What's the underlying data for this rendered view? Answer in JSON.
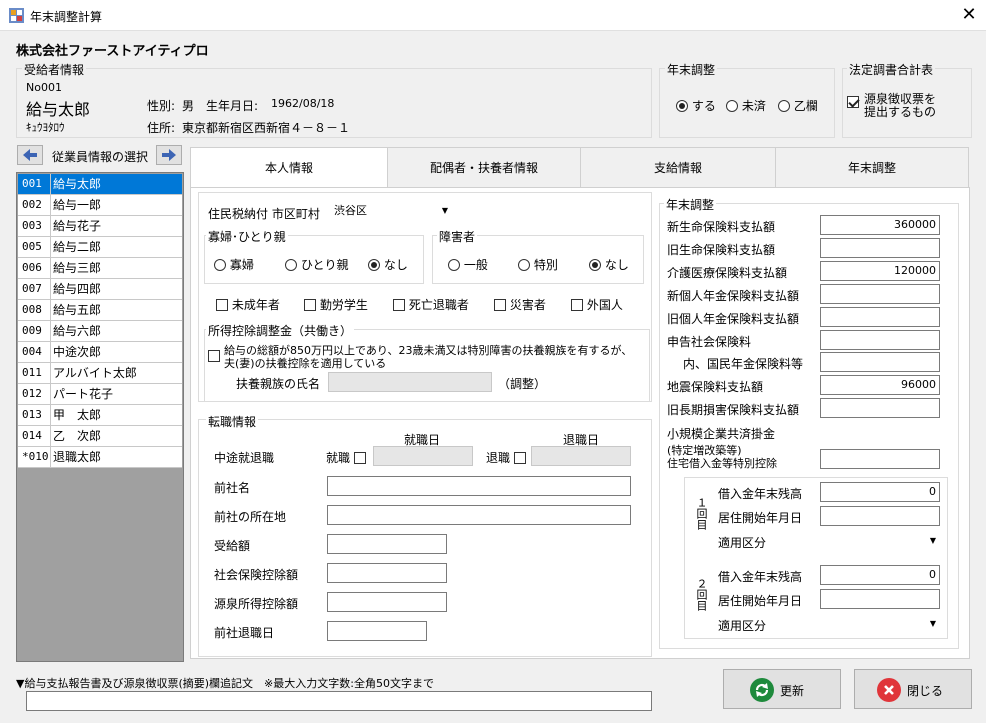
{
  "window": {
    "title": "年末調整計算",
    "close_glyph": "✕"
  },
  "company": "株式会社ファーストアイティプロ",
  "recipient": {
    "group_label": "受給者情報",
    "no": "No001",
    "name": "給与太郎",
    "kana": "ｷｭｳﾖﾀﾛｳ",
    "gender_label": "性別:",
    "gender": "男",
    "birth_label": "生年月日:",
    "birth": "1962/08/18",
    "address_label": "住所:",
    "address": "東京都新宿区西新宿４－８－１"
  },
  "nenmatsu": {
    "group_label": "年末調整",
    "options": [
      "する",
      "未済",
      "乙欄"
    ],
    "selected": 0
  },
  "houtei": {
    "group_label": "法定調書合計表",
    "check_label_1": "源泉徴収票を",
    "check_label_2": "提出するもの",
    "checked": true
  },
  "employee_select": {
    "label": "従業員情報の選択",
    "items": [
      {
        "code": "001",
        "name": "給与太郎"
      },
      {
        "code": "002",
        "name": "給与一郎"
      },
      {
        "code": "003",
        "name": "給与花子"
      },
      {
        "code": "005",
        "name": "給与二郎"
      },
      {
        "code": "006",
        "name": "給与三郎"
      },
      {
        "code": "007",
        "name": "給与四郎"
      },
      {
        "code": "008",
        "name": "給与五郎"
      },
      {
        "code": "009",
        "name": "給与六郎"
      },
      {
        "code": "004",
        "name": "中途次郎"
      },
      {
        "code": "011",
        "name": "アルバイト太郎"
      },
      {
        "code": "012",
        "name": "パート花子"
      },
      {
        "code": "013",
        "name": "甲　太郎"
      },
      {
        "code": "014",
        "name": "乙　次郎"
      },
      {
        "code": "*010",
        "name": "退職太郎"
      }
    ]
  },
  "tabs": [
    "本人情報",
    "配偶者・扶養者情報",
    "支給情報",
    "年末調整"
  ],
  "honnin": {
    "jumin_label": "住民税納付 市区町村",
    "jumin_value": "渋谷区",
    "kafu": {
      "label": "寡婦･ひとり親",
      "options": [
        "寡婦",
        "ひとり親",
        "なし"
      ],
      "selected": 2
    },
    "shogai": {
      "label": "障害者",
      "options": [
        "一般",
        "特別",
        "なし"
      ],
      "selected": 2
    },
    "checks": [
      "未成年者",
      "勤労学生",
      "死亡退職者",
      "災害者",
      "外国人"
    ],
    "shotoku": {
      "label": "所得控除調整金（共働き）",
      "text1": "給与の総額が850万円以上であり、23歳未満又は特別障害の扶養親族を有するが、",
      "text2": "夫(妻)の扶養控除を適用している",
      "fuyo_label": "扶養親族の氏名",
      "chosei": "（調整）"
    },
    "tenshoku": {
      "label": "転職情報",
      "chuto": "中途就退職",
      "shushoku_hi": "就職日",
      "taishoku_hi": "退職日",
      "shushoku": "就職",
      "taishoku": "退職",
      "fields": [
        "前社名",
        "前社の所在地",
        "受給額",
        "社会保険控除額",
        "源泉所得控除額",
        "前社退職日"
      ]
    }
  },
  "nenmatsu_panel": {
    "label": "年末調整",
    "rows": [
      {
        "label": "新生命保険料支払額",
        "value": "360000"
      },
      {
        "label": "旧生命保険料支払額",
        "value": ""
      },
      {
        "label": "介護医療保険料支払額",
        "value": "120000"
      },
      {
        "label": "新個人年金保険料支払額",
        "value": ""
      },
      {
        "label": "旧個人年金保険料支払額",
        "value": ""
      },
      {
        "label": "申告社会保険料",
        "value": ""
      },
      {
        "label": "内、国民年金保険料等",
        "value": ""
      },
      {
        "label": "地震保険料支払額",
        "value": "96000"
      },
      {
        "label": "旧長期損害保険料支払額",
        "value": ""
      },
      {
        "label": "小規模企業共済掛金",
        "value": ""
      }
    ],
    "jutaku_label_1": "(特定増改築等)",
    "jutaku_label_2": "住宅借入金等特別控除",
    "kai1": "１回目",
    "kai2": "２回目",
    "sub1": {
      "zandaka_label": "借入金年末残高",
      "zandaka": "0",
      "kaishi_label": "居住開始年月日",
      "kubun_label": "適用区分"
    },
    "sub2": {
      "zandaka_label": "借入金年末残高",
      "zandaka": "0",
      "kaishi_label": "居住開始年月日",
      "kubun_label": "適用区分"
    }
  },
  "footer": {
    "label": "▼給与支払報告書及び源泉徴収票(摘要)欄追記文　※最大入力文字数:全角50文字まで",
    "update": "更新",
    "close": "閉じる"
  },
  "colors": {
    "selection": "#0078d7",
    "update_icon": "#1e8a3c",
    "close_icon": "#e0353a",
    "arrow": "#3c64b4"
  }
}
